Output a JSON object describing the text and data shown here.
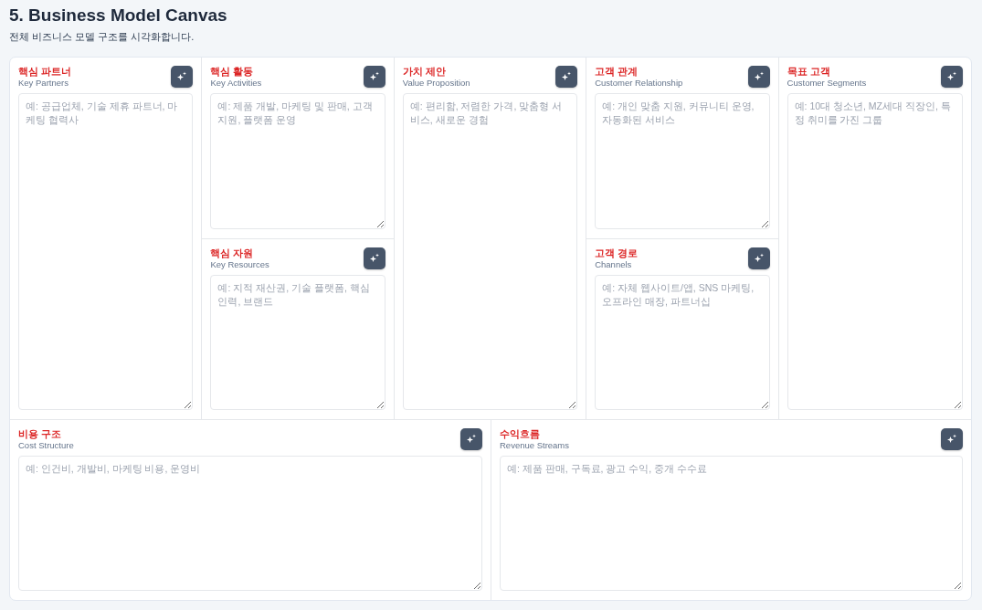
{
  "header": {
    "title": "5. Business Model Canvas",
    "subtitle": "전체 비즈니스 모델 구조를 시각화합니다."
  },
  "top_columns": [
    {
      "blocks": [
        {
          "title": "핵심 파트너",
          "subtitle": "Key Partners",
          "placeholder": "예: 공급업체, 기술 제휴 파트너, 마케팅 협력사"
        }
      ]
    },
    {
      "blocks": [
        {
          "title": "핵심 활동",
          "subtitle": "Key Activities",
          "placeholder": "예: 제품 개발, 마케팅 및 판매, 고객 지원, 플랫폼 운영"
        },
        {
          "title": "핵심 자원",
          "subtitle": "Key Resources",
          "placeholder": "예: 지적 재산권, 기술 플랫폼, 핵심 인력, 브랜드"
        }
      ]
    },
    {
      "blocks": [
        {
          "title": "가치 제안",
          "subtitle": "Value Proposition",
          "placeholder": "예: 편리함, 저렴한 가격, 맞춤형 서비스, 새로운 경험"
        }
      ]
    },
    {
      "blocks": [
        {
          "title": "고객 관계",
          "subtitle": "Customer Relationship",
          "placeholder": "예: 개인 맞춤 지원, 커뮤니티 운영, 자동화된 서비스"
        },
        {
          "title": "고객 경로",
          "subtitle": "Channels",
          "placeholder": "예: 자체 웹사이트/앱, SNS 마케팅, 오프라인 매장, 파트너십"
        }
      ]
    },
    {
      "blocks": [
        {
          "title": "목표 고객",
          "subtitle": "Customer Segments",
          "placeholder": "예: 10대 청소년, MZ세대 직장인, 특정 취미를 가진 그룹"
        }
      ]
    }
  ],
  "bottom_blocks": [
    {
      "title": "비용 구조",
      "subtitle": "Cost Structure",
      "placeholder": "예: 인건비, 개발비, 마케팅 비용, 운영비"
    },
    {
      "title": "수익흐름",
      "subtitle": "Revenue Streams",
      "placeholder": "예: 제품 판매, 구독료, 광고 수익, 중개 수수료"
    }
  ]
}
